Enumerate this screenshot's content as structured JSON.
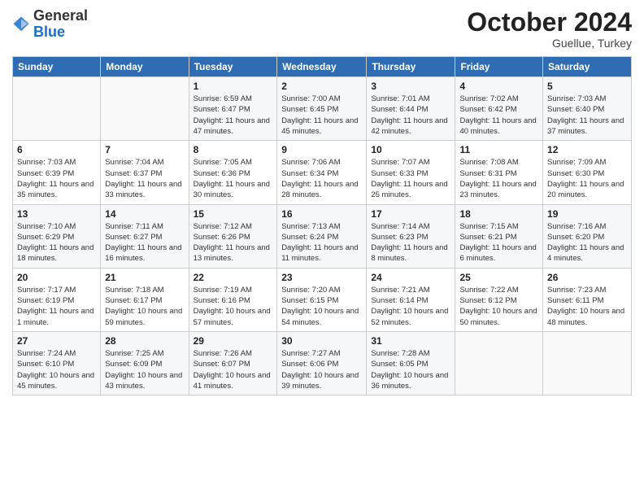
{
  "header": {
    "logo_line1": "General",
    "logo_line2": "Blue",
    "month": "October 2024",
    "location": "Guellue, Turkey"
  },
  "weekdays": [
    "Sunday",
    "Monday",
    "Tuesday",
    "Wednesday",
    "Thursday",
    "Friday",
    "Saturday"
  ],
  "weeks": [
    [
      {
        "day": "",
        "info": ""
      },
      {
        "day": "",
        "info": ""
      },
      {
        "day": "1",
        "info": "Sunrise: 6:59 AM\nSunset: 6:47 PM\nDaylight: 11 hours and 47 minutes."
      },
      {
        "day": "2",
        "info": "Sunrise: 7:00 AM\nSunset: 6:45 PM\nDaylight: 11 hours and 45 minutes."
      },
      {
        "day": "3",
        "info": "Sunrise: 7:01 AM\nSunset: 6:44 PM\nDaylight: 11 hours and 42 minutes."
      },
      {
        "day": "4",
        "info": "Sunrise: 7:02 AM\nSunset: 6:42 PM\nDaylight: 11 hours and 40 minutes."
      },
      {
        "day": "5",
        "info": "Sunrise: 7:03 AM\nSunset: 6:40 PM\nDaylight: 11 hours and 37 minutes."
      }
    ],
    [
      {
        "day": "6",
        "info": "Sunrise: 7:03 AM\nSunset: 6:39 PM\nDaylight: 11 hours and 35 minutes."
      },
      {
        "day": "7",
        "info": "Sunrise: 7:04 AM\nSunset: 6:37 PM\nDaylight: 11 hours and 33 minutes."
      },
      {
        "day": "8",
        "info": "Sunrise: 7:05 AM\nSunset: 6:36 PM\nDaylight: 11 hours and 30 minutes."
      },
      {
        "day": "9",
        "info": "Sunrise: 7:06 AM\nSunset: 6:34 PM\nDaylight: 11 hours and 28 minutes."
      },
      {
        "day": "10",
        "info": "Sunrise: 7:07 AM\nSunset: 6:33 PM\nDaylight: 11 hours and 25 minutes."
      },
      {
        "day": "11",
        "info": "Sunrise: 7:08 AM\nSunset: 6:31 PM\nDaylight: 11 hours and 23 minutes."
      },
      {
        "day": "12",
        "info": "Sunrise: 7:09 AM\nSunset: 6:30 PM\nDaylight: 11 hours and 20 minutes."
      }
    ],
    [
      {
        "day": "13",
        "info": "Sunrise: 7:10 AM\nSunset: 6:29 PM\nDaylight: 11 hours and 18 minutes."
      },
      {
        "day": "14",
        "info": "Sunrise: 7:11 AM\nSunset: 6:27 PM\nDaylight: 11 hours and 16 minutes."
      },
      {
        "day": "15",
        "info": "Sunrise: 7:12 AM\nSunset: 6:26 PM\nDaylight: 11 hours and 13 minutes."
      },
      {
        "day": "16",
        "info": "Sunrise: 7:13 AM\nSunset: 6:24 PM\nDaylight: 11 hours and 11 minutes."
      },
      {
        "day": "17",
        "info": "Sunrise: 7:14 AM\nSunset: 6:23 PM\nDaylight: 11 hours and 8 minutes."
      },
      {
        "day": "18",
        "info": "Sunrise: 7:15 AM\nSunset: 6:21 PM\nDaylight: 11 hours and 6 minutes."
      },
      {
        "day": "19",
        "info": "Sunrise: 7:16 AM\nSunset: 6:20 PM\nDaylight: 11 hours and 4 minutes."
      }
    ],
    [
      {
        "day": "20",
        "info": "Sunrise: 7:17 AM\nSunset: 6:19 PM\nDaylight: 11 hours and 1 minute."
      },
      {
        "day": "21",
        "info": "Sunrise: 7:18 AM\nSunset: 6:17 PM\nDaylight: 10 hours and 59 minutes."
      },
      {
        "day": "22",
        "info": "Sunrise: 7:19 AM\nSunset: 6:16 PM\nDaylight: 10 hours and 57 minutes."
      },
      {
        "day": "23",
        "info": "Sunrise: 7:20 AM\nSunset: 6:15 PM\nDaylight: 10 hours and 54 minutes."
      },
      {
        "day": "24",
        "info": "Sunrise: 7:21 AM\nSunset: 6:14 PM\nDaylight: 10 hours and 52 minutes."
      },
      {
        "day": "25",
        "info": "Sunrise: 7:22 AM\nSunset: 6:12 PM\nDaylight: 10 hours and 50 minutes."
      },
      {
        "day": "26",
        "info": "Sunrise: 7:23 AM\nSunset: 6:11 PM\nDaylight: 10 hours and 48 minutes."
      }
    ],
    [
      {
        "day": "27",
        "info": "Sunrise: 7:24 AM\nSunset: 6:10 PM\nDaylight: 10 hours and 45 minutes."
      },
      {
        "day": "28",
        "info": "Sunrise: 7:25 AM\nSunset: 6:09 PM\nDaylight: 10 hours and 43 minutes."
      },
      {
        "day": "29",
        "info": "Sunrise: 7:26 AM\nSunset: 6:07 PM\nDaylight: 10 hours and 41 minutes."
      },
      {
        "day": "30",
        "info": "Sunrise: 7:27 AM\nSunset: 6:06 PM\nDaylight: 10 hours and 39 minutes."
      },
      {
        "day": "31",
        "info": "Sunrise: 7:28 AM\nSunset: 6:05 PM\nDaylight: 10 hours and 36 minutes."
      },
      {
        "day": "",
        "info": ""
      },
      {
        "day": "",
        "info": ""
      }
    ]
  ]
}
